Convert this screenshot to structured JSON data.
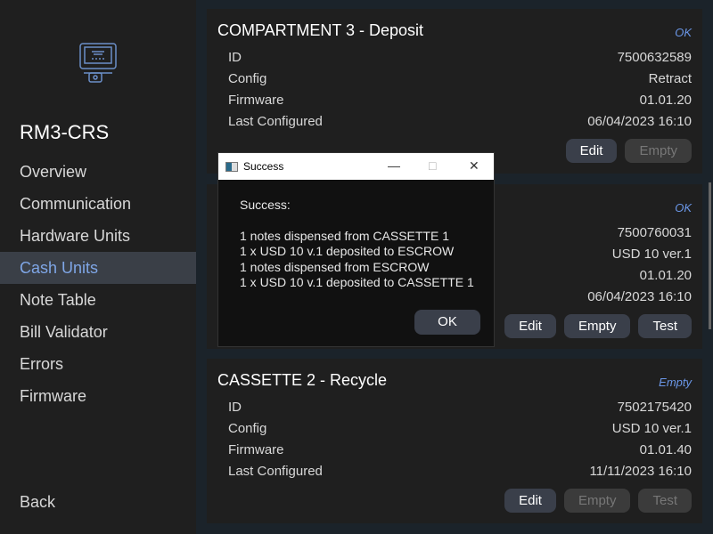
{
  "sidebar": {
    "device": "RM3-CRS",
    "items": [
      {
        "label": "Overview"
      },
      {
        "label": "Communication"
      },
      {
        "label": "Hardware Units"
      },
      {
        "label": "Cash Units",
        "active": true
      },
      {
        "label": "Note Table"
      },
      {
        "label": "Bill Validator"
      },
      {
        "label": "Errors"
      },
      {
        "label": "Firmware"
      }
    ],
    "back": "Back",
    "logo_icon": "atm-icon"
  },
  "labels": {
    "id": "ID",
    "config": "Config",
    "firmware": "Firmware",
    "last": "Last Configured",
    "edit": "Edit",
    "empty": "Empty",
    "test": "Test"
  },
  "cards": [
    {
      "title": "COMPARTMENT 3 - Deposit",
      "status": "OK",
      "id": "7500632589",
      "config": "Retract",
      "firmware": "01.01.20",
      "last": "06/04/2023 16:10"
    },
    {
      "title": "",
      "status": "OK",
      "id": "7500760031",
      "config": "USD 10 ver.1",
      "firmware": "01.01.20",
      "last": "06/04/2023 16:10"
    },
    {
      "title": "CASSETTE 2 - Recycle",
      "status": "Empty",
      "id": "7502175420",
      "config": "USD 10 ver.1",
      "firmware": "01.01.40",
      "last": "11/11/2023 16:10"
    }
  ],
  "dialog": {
    "title": "Success",
    "heading": "Success:",
    "lines": [
      "1 notes dispensed from CASSETTE 1",
      "1 x USD 10 v.1 deposited to ESCROW",
      "1 notes dispensed from ESCROW",
      "1 x USD 10 v.1 deposited to CASSETTE 1"
    ],
    "ok": "OK"
  }
}
